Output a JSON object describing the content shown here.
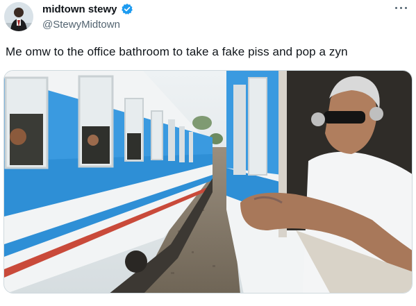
{
  "post": {
    "author": {
      "display_name": "midtown stewy",
      "handle": "@StewyMidtown",
      "verified": true,
      "avatar_icon": "user-avatar"
    },
    "text": "Me omw to the office bathroom to take a fake piss and pop a zyn",
    "more_icon": "more-horizontal-icon",
    "verified_icon": "verified-badge-icon",
    "verified_color": "#1d9bf0"
  }
}
